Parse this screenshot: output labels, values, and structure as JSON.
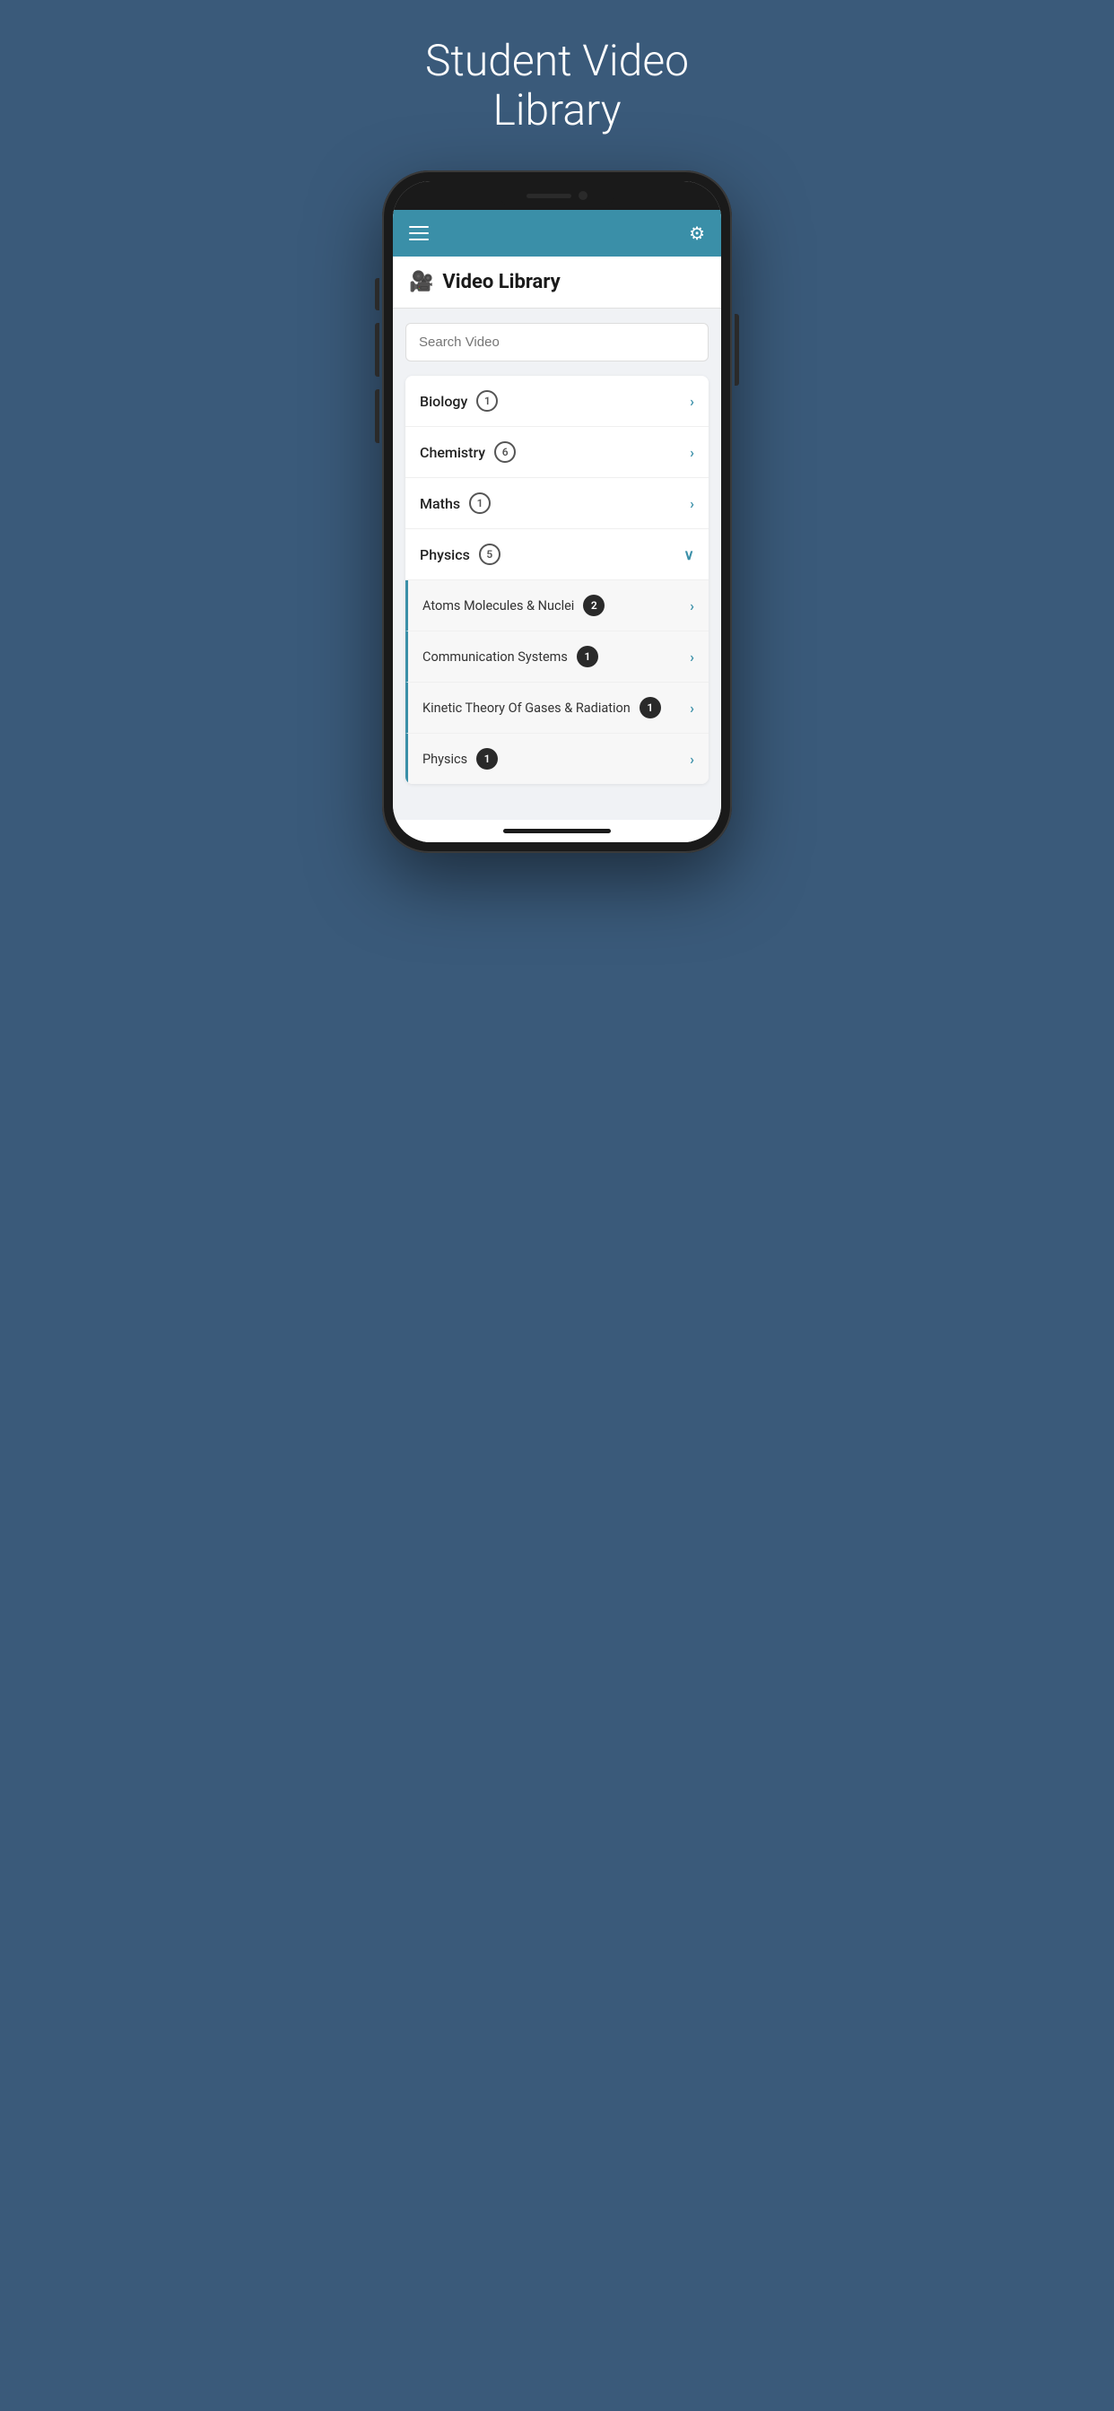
{
  "page": {
    "title_line1": "Student Video",
    "title_line2": "Library"
  },
  "header": {
    "menu_icon": "☰",
    "settings_icon": "⚙",
    "app_title": "Video Library",
    "camera_icon": "🎥"
  },
  "search": {
    "placeholder": "Search Video"
  },
  "categories": [
    {
      "id": "biology",
      "name": "Biology",
      "count": 1,
      "expanded": false,
      "badge_type": "outline"
    },
    {
      "id": "chemistry",
      "name": "Chemistry",
      "count": 6,
      "expanded": false,
      "badge_type": "outline"
    },
    {
      "id": "maths",
      "name": "Maths",
      "count": 1,
      "expanded": false,
      "badge_type": "outline"
    },
    {
      "id": "physics",
      "name": "Physics",
      "count": 5,
      "expanded": true,
      "badge_type": "outline"
    }
  ],
  "physics_subcategories": [
    {
      "id": "atoms",
      "name": "Atoms Molecules & Nuclei",
      "count": 2,
      "badge_type": "dark"
    },
    {
      "id": "communication",
      "name": "Communication Systems",
      "count": 1,
      "badge_type": "dark"
    },
    {
      "id": "kinetic",
      "name": "Kinetic Theory Of Gases & Radiation",
      "count": 1,
      "badge_type": "dark"
    },
    {
      "id": "physics_sub",
      "name": "Physics",
      "count": 1,
      "badge_type": "dark"
    }
  ]
}
